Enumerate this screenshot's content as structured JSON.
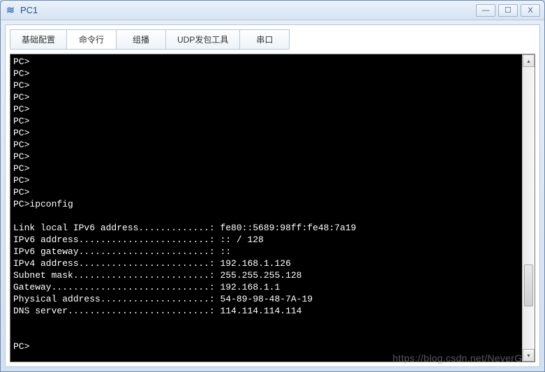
{
  "window": {
    "title": "PC1",
    "icon_glyph": "≋"
  },
  "tabs": [
    {
      "label": "基础配置"
    },
    {
      "label": "命令行"
    },
    {
      "label": "组播"
    },
    {
      "label": "UDP发包工具"
    },
    {
      "label": "串口"
    }
  ],
  "active_tab_index": 1,
  "terminal": {
    "prompt": "PC>",
    "command": "ipconfig",
    "empty_prompt_count": 12,
    "output": {
      "link_local_ipv6": "fe80::5689:98ff:fe48:7a19",
      "ipv6_address": ":: / 128",
      "ipv6_gateway": "::",
      "ipv4_address": "192.168.1.126",
      "subnet_mask": "255.255.255.128",
      "gateway": "192.168.1.1",
      "physical_address": "54-89-98-48-7A-19",
      "dns_server": "114.114.114.114"
    },
    "labels": {
      "link_local_ipv6": "Link local IPv6 address",
      "ipv6_address": "IPv6 address",
      "ipv6_gateway": "IPv6 gateway",
      "ipv4_address": "IPv4 address",
      "subnet_mask": "Subnet mask",
      "gateway": "Gateway",
      "physical_address": "Physical address",
      "dns_server": "DNS server"
    }
  },
  "watermark": "https://blog.csdn.net/NeverG..."
}
